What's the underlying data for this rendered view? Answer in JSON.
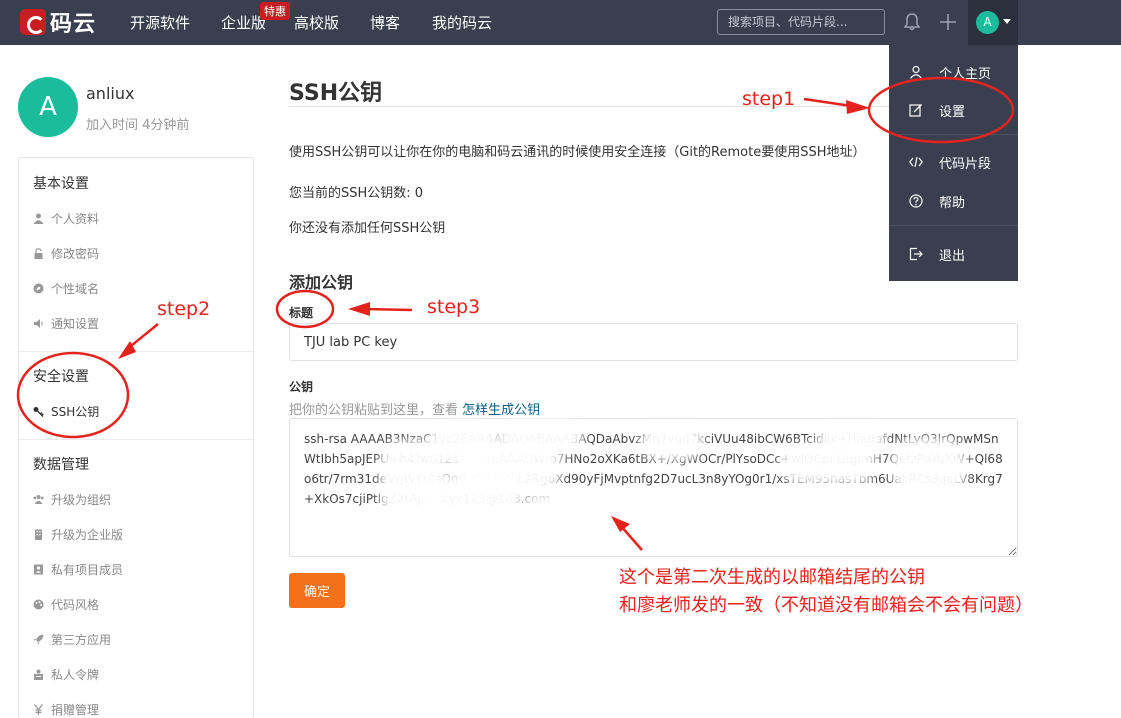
{
  "nav": {
    "logo_text": "码云",
    "items": [
      "开源软件",
      "企业版",
      "高校版",
      "博客",
      "我的码云"
    ],
    "badge": "特惠",
    "search_placeholder": "搜索项目、代码片段...",
    "avatar_letter": "A"
  },
  "dropdown": {
    "items": [
      {
        "label": "个人主页",
        "icon": "user-icon"
      },
      {
        "label": "设置",
        "icon": "edit-icon"
      },
      {
        "label": "代码片段",
        "icon": "code-icon"
      },
      {
        "label": "帮助",
        "icon": "help-icon"
      },
      {
        "label": "退出",
        "icon": "logout-icon"
      }
    ]
  },
  "profile": {
    "avatar_letter": "A",
    "name": "anliux",
    "joined": "加入时间 4分钟前"
  },
  "sidebar": {
    "basic": {
      "heading": "基本设置",
      "items": [
        "个人资料",
        "修改密码",
        "个性域名",
        "通知设置"
      ]
    },
    "security": {
      "heading": "安全设置",
      "items": [
        "SSH公钥"
      ]
    },
    "data": {
      "heading": "数据管理",
      "items": [
        "升级为组织",
        "升级为企业版",
        "私有项目成员",
        "代码风格",
        "第三方应用",
        "私人令牌",
        "捐赠管理"
      ]
    }
  },
  "main": {
    "title": "SSH公钥",
    "description": "使用SSH公钥可以让你在你的电脑和码云通讯的时候使用安全连接（Git的Remote要使用SSH地址）",
    "count_label": "您当前的SSH公钥数: 0",
    "none_text": "你还没有添加任何SSH公钥",
    "add_heading": "添加公钥",
    "title_label": "标题",
    "title_value": "TJU lab PC key",
    "key_label": "公钥",
    "key_hint": "把你的公钥粘贴到这里，查看",
    "key_hint_link": "怎样生成公钥",
    "key_value": "ssh-rsa AAAAB3NzaC1yc2EAAAADAQABAAABAQDaAbvzMh7vud7kciVUu48ibCW6BTcidiJk+HiadafdNtLyQ3JrQpwMSnWtIbh5apJEPU+h4Tw61219pkNbAAAOWro7HNo2oXKa6tBX+/XgWOCr/PlYsoDCc+wiOCpFGqpmH7QefzPoYuXW+Ql68o6tr/7rm31deVrjWYr0sQgGzQbAMuL2Rg6Xd90yFjMvptnfg2D7ucL3n8yYOg0r1/xsTEM95hasTbm6UakRCs3qaLV8Krg7+XkOs7cjiPtlgZ2tAj luckyx123@163.com",
    "submit_label": "确定"
  },
  "annotations": {
    "step1": "step1",
    "step2": "step2",
    "step3": "step3",
    "note_line1": "这个是第二次生成的以邮箱结尾的公钥",
    "note_line2": "和廖老师发的一致（不知道没有邮箱会不会有问题）"
  }
}
